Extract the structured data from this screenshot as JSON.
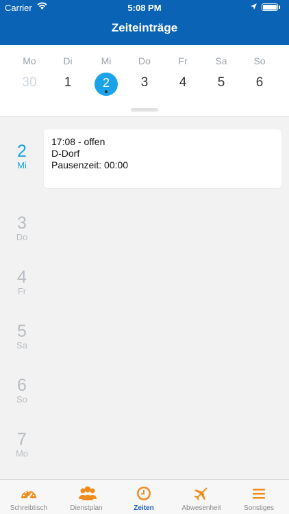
{
  "status": {
    "carrier": "Carrier",
    "time": "5:08 PM"
  },
  "header": {
    "title": "Zeiteinträge"
  },
  "week": {
    "weekdays": [
      "Mo",
      "Di",
      "Mi",
      "Do",
      "Fr",
      "Sa",
      "So"
    ],
    "dates": [
      "30",
      "1",
      "2",
      "3",
      "4",
      "5",
      "6"
    ],
    "selected_index": 2
  },
  "days": [
    {
      "num": "2",
      "abbr": "Mi"
    },
    {
      "num": "3",
      "abbr": "Do"
    },
    {
      "num": "4",
      "abbr": "Fr"
    },
    {
      "num": "5",
      "abbr": "Sa"
    },
    {
      "num": "6",
      "abbr": "So"
    },
    {
      "num": "7",
      "abbr": "Mo"
    }
  ],
  "entry": {
    "time": "17:08 - offen",
    "location": "D-Dorf",
    "pause": "Pausenzeit: 00:00"
  },
  "tabs": [
    {
      "label": "Schreibtisch",
      "icon": "speedometer-icon"
    },
    {
      "label": "Dienstplan",
      "icon": "group-icon"
    },
    {
      "label": "Zeiten",
      "icon": "clock-icon"
    },
    {
      "label": "Abwesenheit",
      "icon": "airplane-icon"
    },
    {
      "label": "Sonstiges",
      "icon": "menu-icon"
    }
  ],
  "colors": {
    "header": "#0b63b5",
    "accent": "#1aa3e8",
    "tab_icon": "#f08c1e",
    "tab_active": "#1a62b5"
  }
}
